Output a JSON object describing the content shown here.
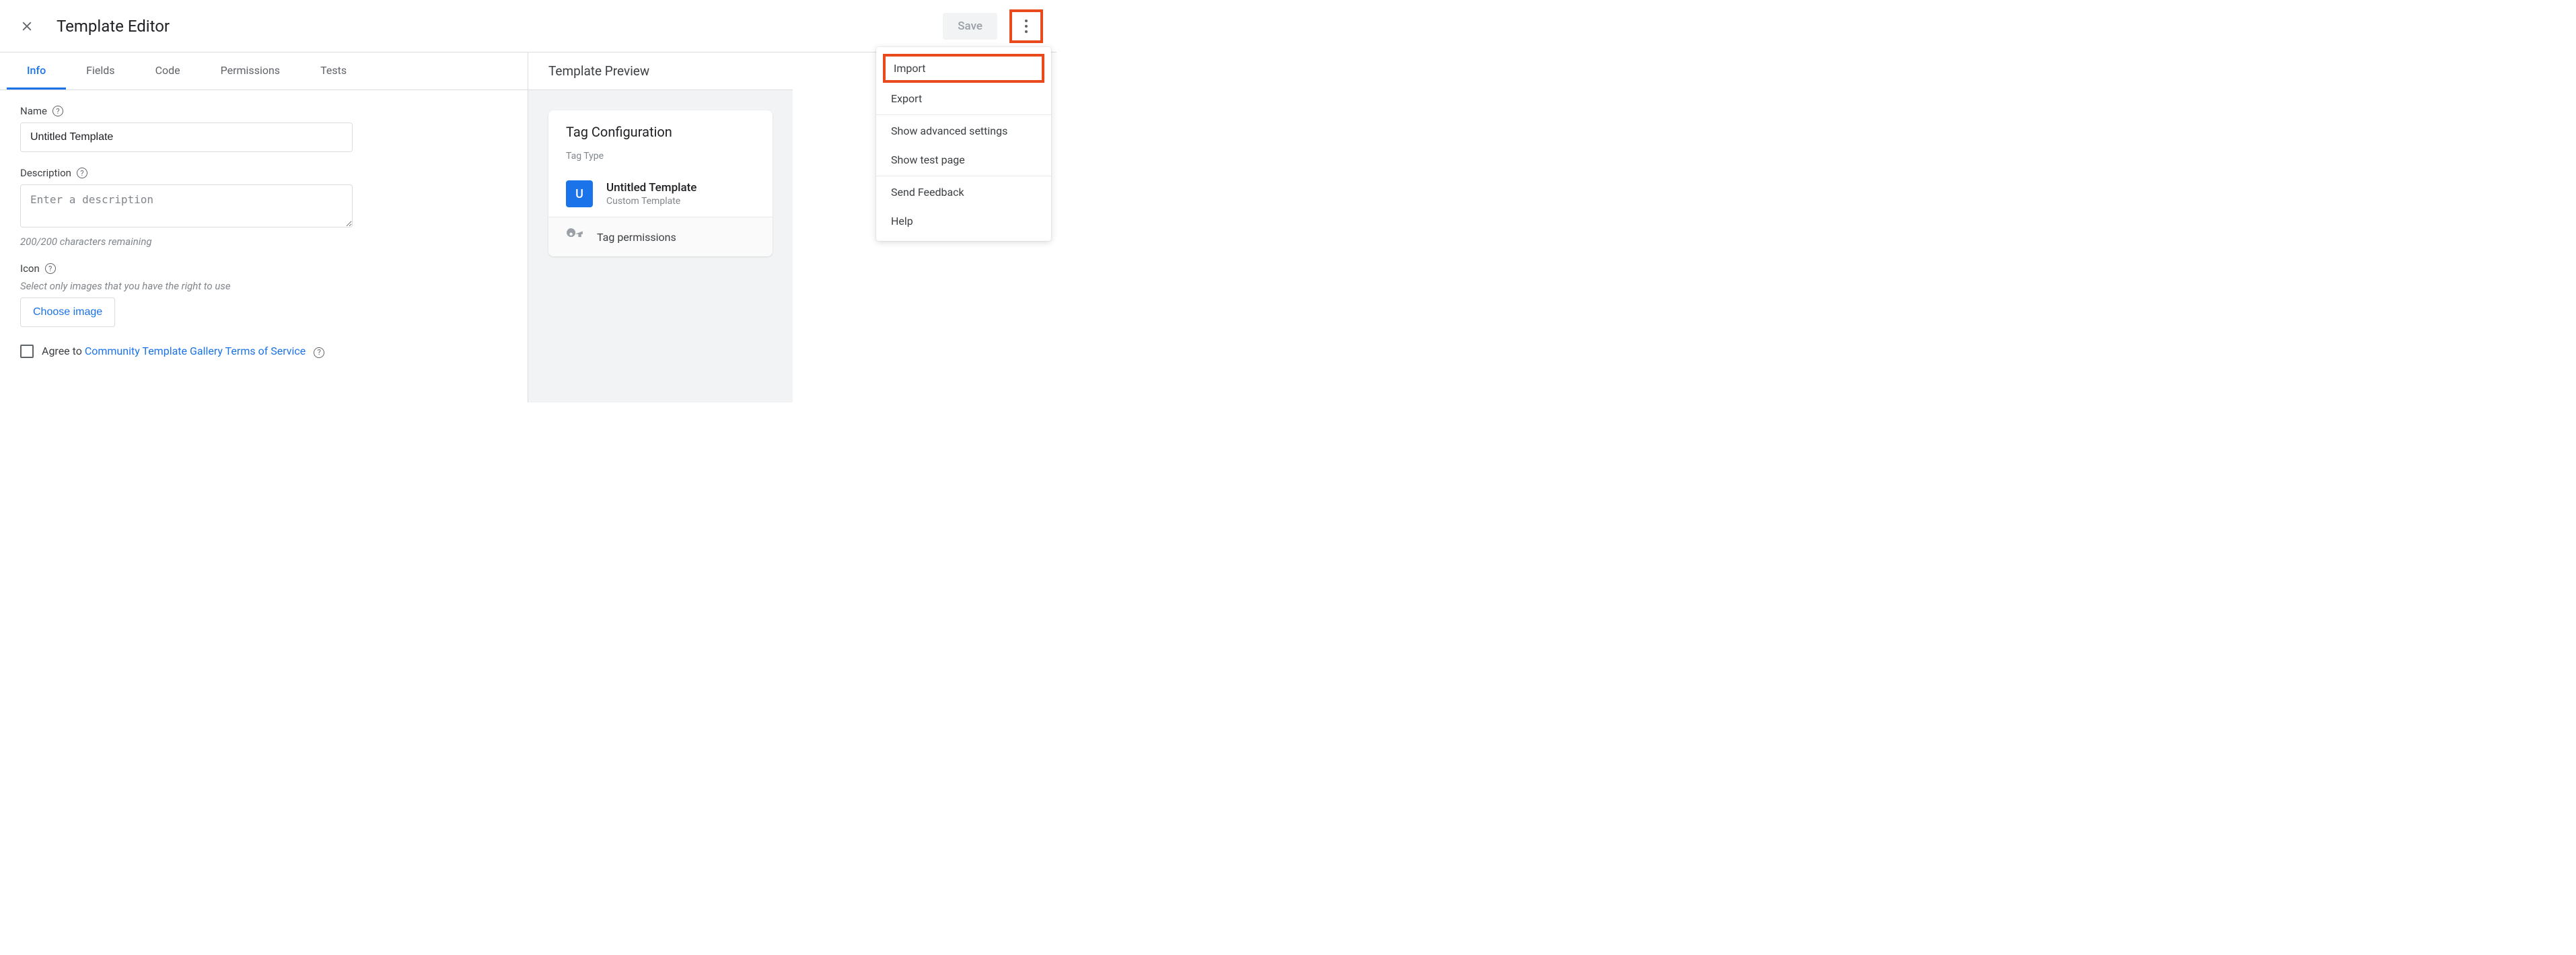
{
  "header": {
    "title": "Template Editor",
    "save_label": "Save"
  },
  "menu": {
    "import": "Import",
    "export": "Export",
    "advanced": "Show advanced settings",
    "test_page": "Show test page",
    "feedback": "Send Feedback",
    "help": "Help"
  },
  "tabs": {
    "info": "Info",
    "fields": "Fields",
    "code": "Code",
    "permissions": "Permissions",
    "tests": "Tests"
  },
  "form": {
    "name_label": "Name",
    "name_value": "Untitled Template",
    "desc_label": "Description",
    "desc_placeholder": "Enter a description",
    "desc_hint": "200/200 characters remaining",
    "icon_label": "Icon",
    "icon_hint": "Select only images that you have the right to use",
    "choose_image": "Choose image",
    "agree_prefix": "Agree to ",
    "tos_link": "Community Template Gallery Terms of Service"
  },
  "preview": {
    "title": "Template Preview",
    "card_title": "Tag Configuration",
    "tag_type_label": "Tag Type",
    "template_name": "Untitled Template",
    "template_kind": "Custom Template",
    "template_initial": "U",
    "permissions_label": "Tag permissions"
  }
}
